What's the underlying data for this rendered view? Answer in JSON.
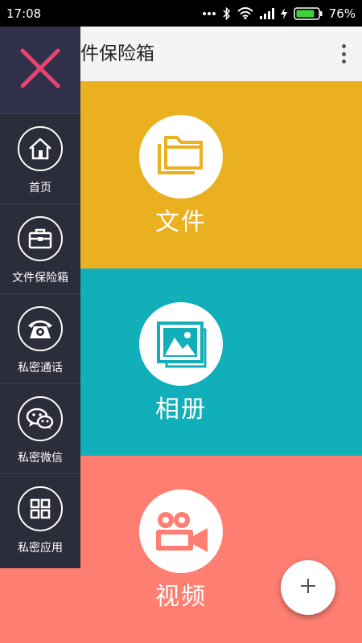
{
  "status_bar": {
    "time": "17:08",
    "battery": "76%"
  },
  "app_bar": {
    "title": "件保险箱"
  },
  "tiles": [
    {
      "label": "文件",
      "icon": "folder-icon",
      "color": "#eab01f"
    },
    {
      "label": "相册",
      "icon": "photo-icon",
      "color": "#11afb9"
    },
    {
      "label": "视频",
      "icon": "video-camera-icon",
      "color": "#fe7f71"
    }
  ],
  "side_menu": {
    "close_icon_color": "#e8446f",
    "items": [
      {
        "label": "首页",
        "icon": "home-icon"
      },
      {
        "label": "文件保险箱",
        "icon": "briefcase-icon"
      },
      {
        "label": "私密通话",
        "icon": "phone-icon"
      },
      {
        "label": "私密微信",
        "icon": "wechat-icon"
      },
      {
        "label": "私密应用",
        "icon": "apps-grid-icon"
      }
    ]
  },
  "fab": {
    "icon": "plus-icon"
  }
}
